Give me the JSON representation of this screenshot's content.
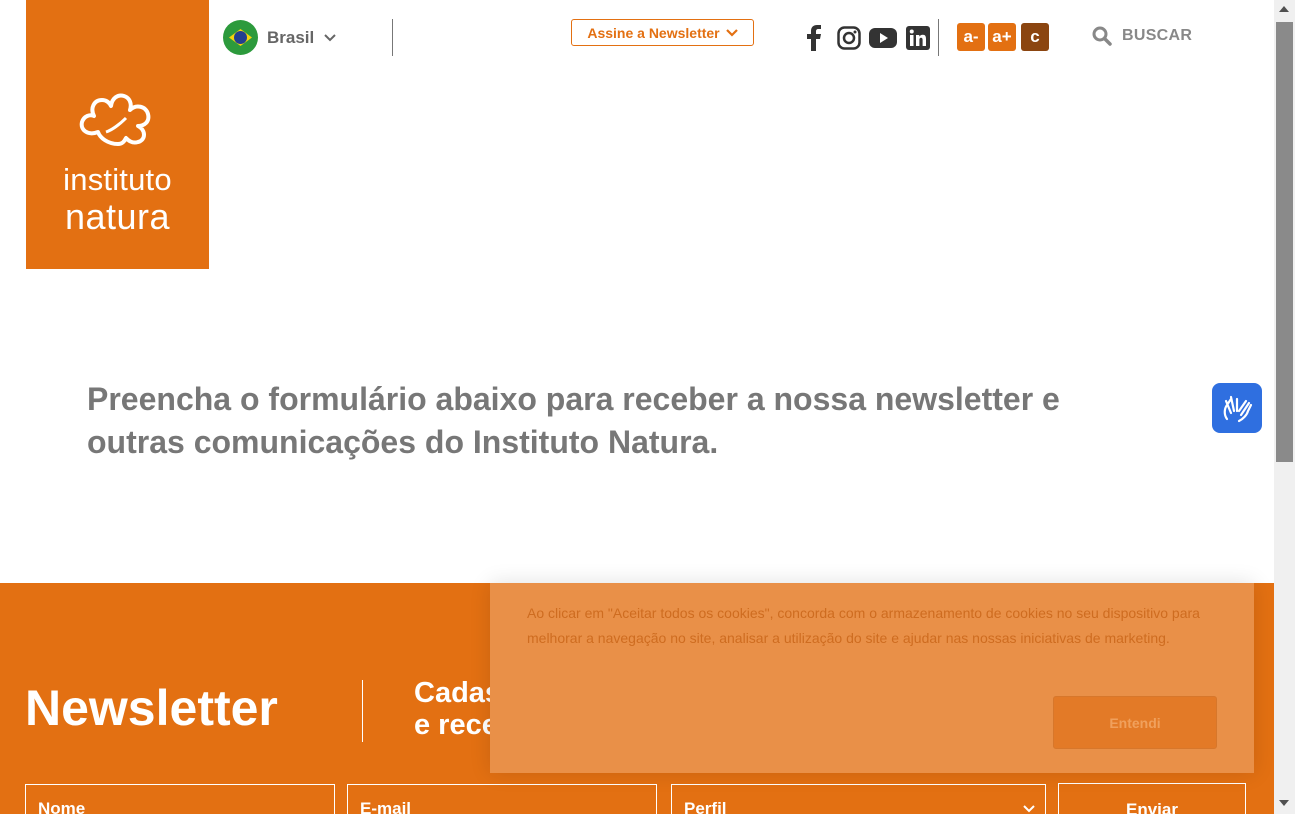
{
  "header": {
    "logo": {
      "line1": "instituto",
      "line2": "natura",
      "icon": "natura-flower-logo"
    },
    "country": {
      "label": "Brasil",
      "icon": "brazil-flag-icon"
    },
    "newsletter_button": "Assine a Newsletter",
    "social": [
      "facebook-icon",
      "instagram-icon",
      "youtube-icon",
      "linkedin-icon"
    ],
    "font_controls": [
      {
        "label": "a-",
        "color": "#e37012"
      },
      {
        "label": "a+",
        "color": "#e37012"
      },
      {
        "label": "c",
        "color": "#8b4510"
      }
    ],
    "search_label": "BUSCAR"
  },
  "main": {
    "intro": "Preencha o formulário abaixo para receber a nossa newsletter e outras comunicações do Instituto Natura."
  },
  "newsletter": {
    "title": "Newsletter",
    "subtitle_line1": "Cadastre-se",
    "subtitle_line2": "e receba a nossa newsletter",
    "fields": {
      "name": "Nome",
      "email": "E-mail",
      "profile": "Perfil"
    },
    "submit": "Enviar"
  },
  "cookie": {
    "text": "Ao clicar em \"Aceitar todos os cookies\", concorda com o armazenamento de cookies no seu dispositivo para melhorar a navegação no site, analisar a utilização do site e ajudar nas nossas iniciativas de marketing.",
    "button": "Entendi"
  },
  "colors": {
    "brand_orange": "#e37012",
    "accessibility_blue": "#2f6fe0",
    "text_gray": "#777777"
  }
}
